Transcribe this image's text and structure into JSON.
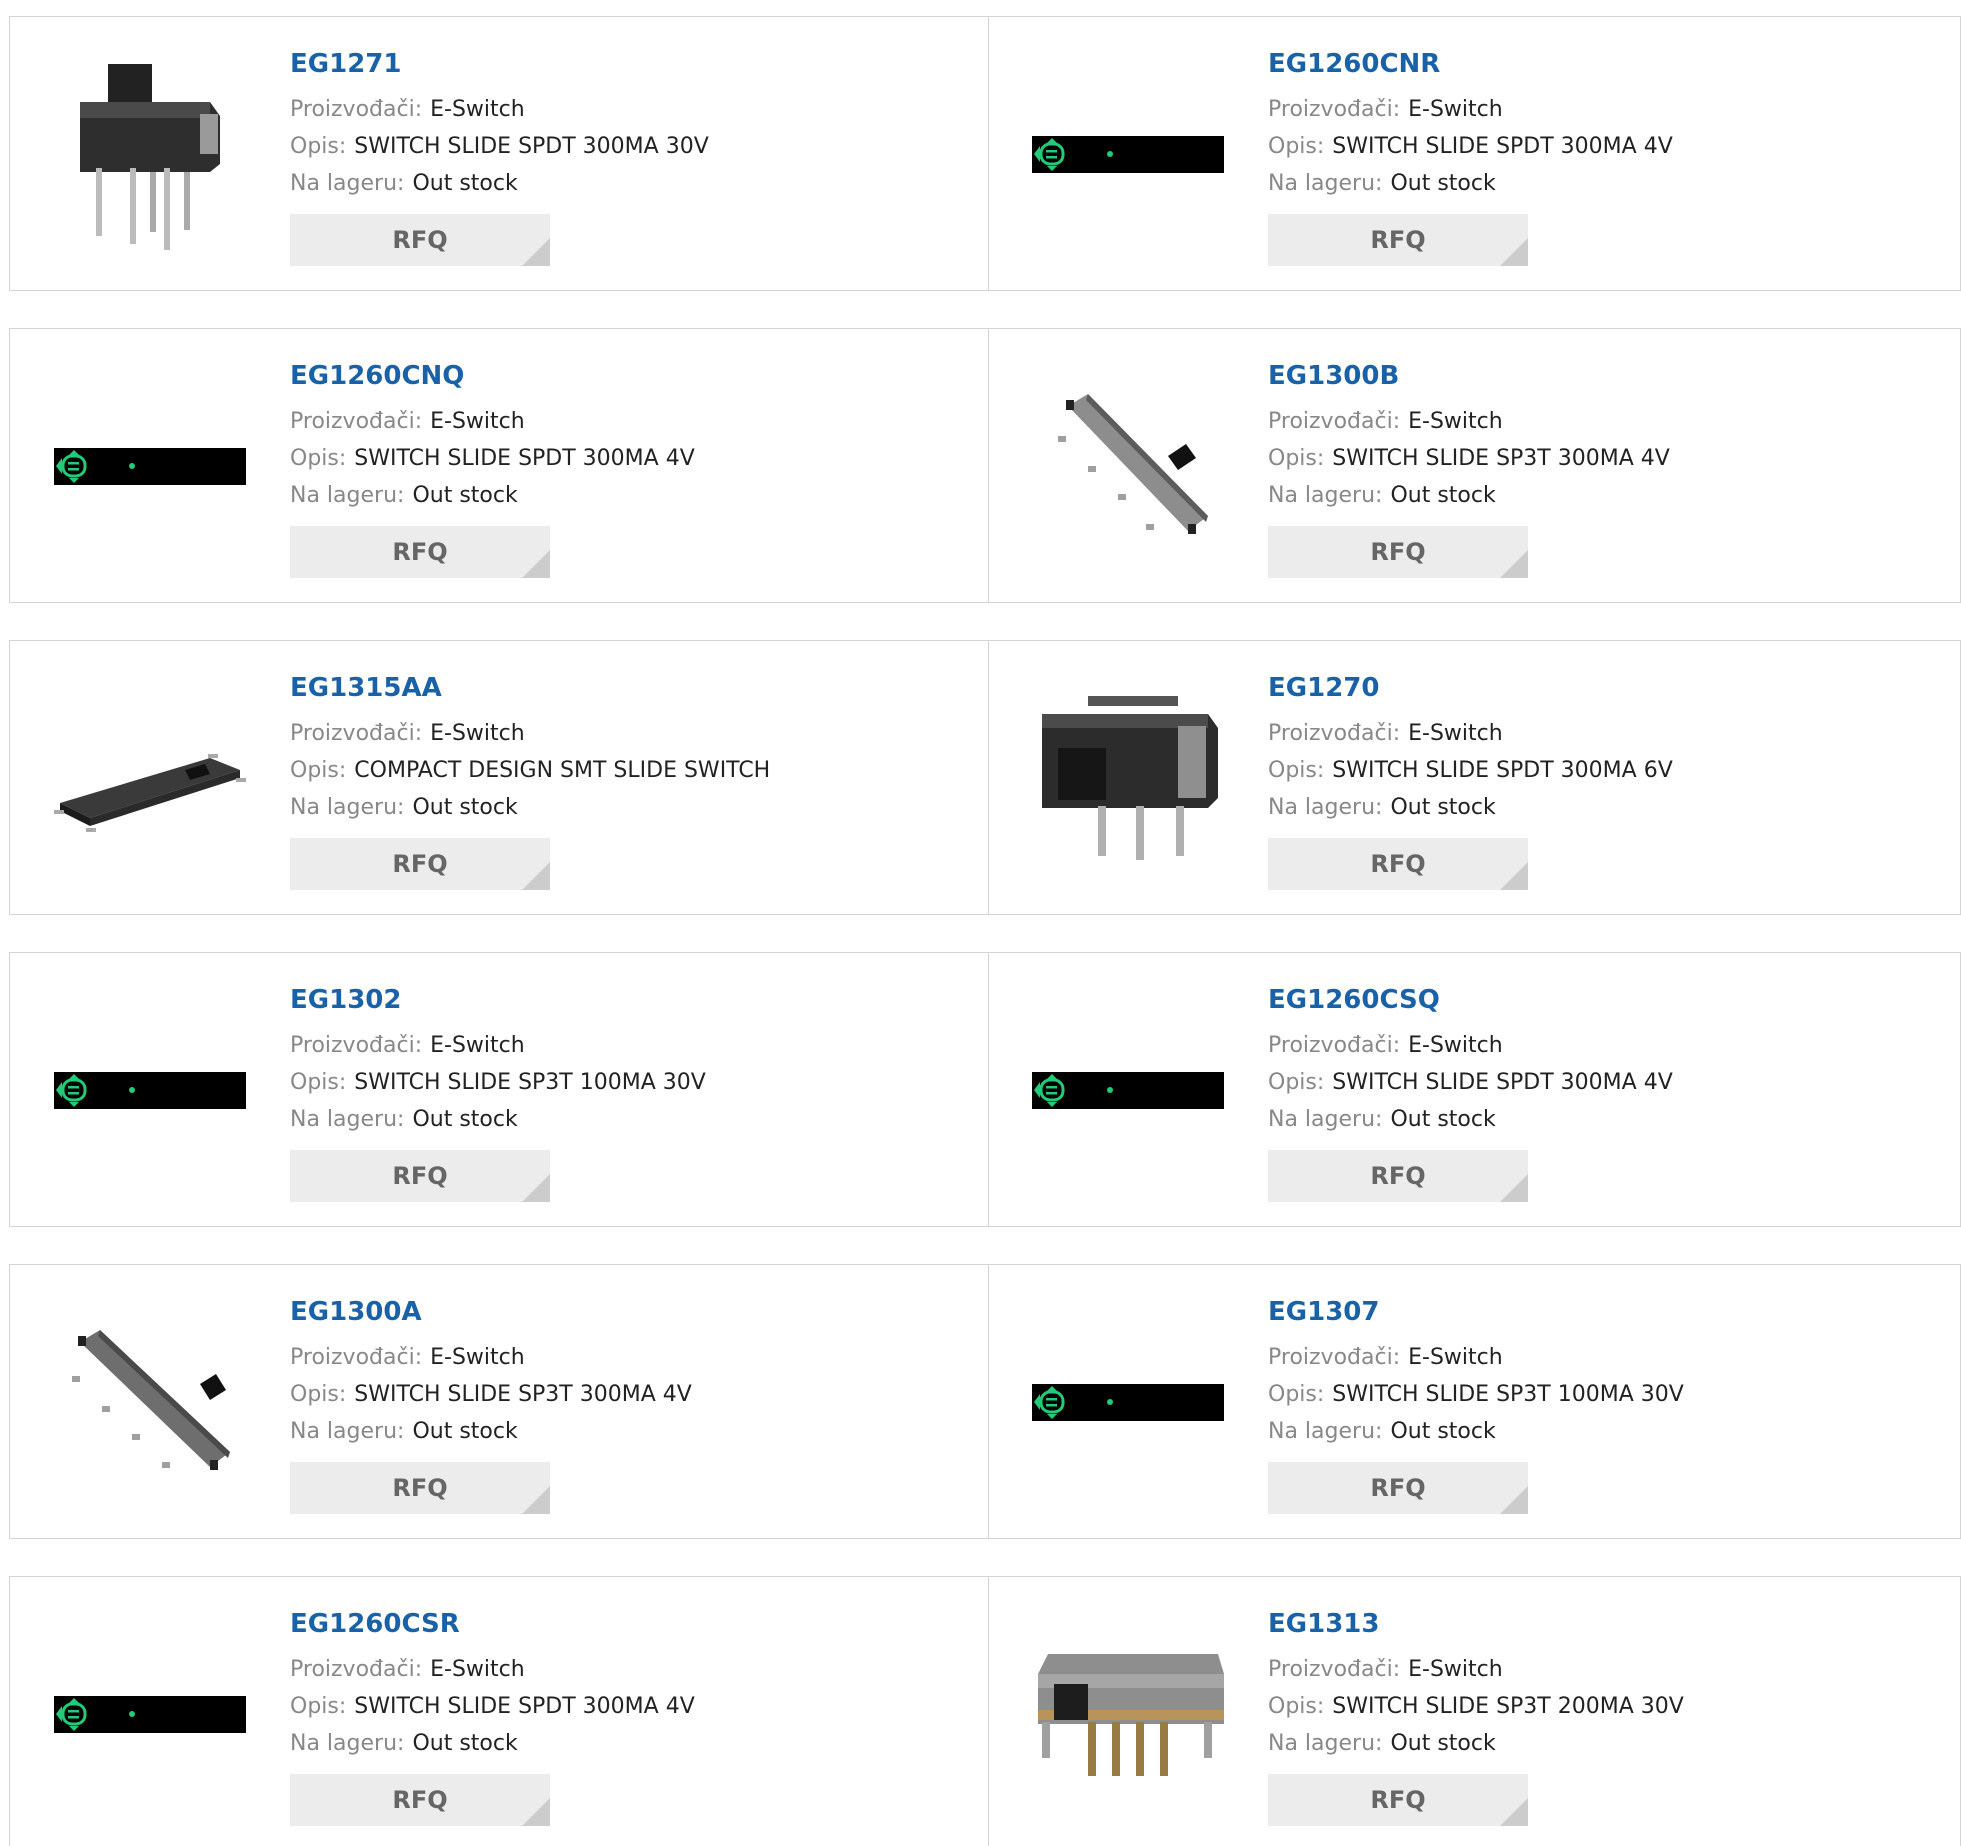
{
  "labels": {
    "manufacturer": "Proizvođači:",
    "description": "Opis:",
    "stock": "Na lageru:",
    "rfq": "RFQ"
  },
  "products": [
    {
      "name": "EG1271",
      "manufacturer": "E-Switch",
      "description": "SWITCH SLIDE SPDT 300MA 30V",
      "stock": "Out stock",
      "image": "slide-switch-through-hole"
    },
    {
      "name": "EG1260CNR",
      "manufacturer": "E-Switch",
      "description": "SWITCH SLIDE SPDT 300MA 4V",
      "stock": "Out stock",
      "image": "placeholder"
    },
    {
      "name": "EG1260CNQ",
      "manufacturer": "E-Switch",
      "description": "SWITCH SLIDE SPDT 300MA 4V",
      "stock": "Out stock",
      "image": "placeholder"
    },
    {
      "name": "EG1300B",
      "manufacturer": "E-Switch",
      "description": "SWITCH SLIDE SP3T 300MA 4V",
      "stock": "Out stock",
      "image": "slide-switch-smt-angled"
    },
    {
      "name": "EG1315AA",
      "manufacturer": "E-Switch",
      "description": "COMPACT DESIGN SMT SLIDE SWITCH",
      "stock": "Out stock",
      "image": "slide-switch-smt-flat"
    },
    {
      "name": "EG1270",
      "manufacturer": "E-Switch",
      "description": "SWITCH SLIDE SPDT 300MA 6V",
      "stock": "Out stock",
      "image": "slide-switch-through-hole-wide"
    },
    {
      "name": "EG1302",
      "manufacturer": "E-Switch",
      "description": "SWITCH SLIDE SP3T 100MA 30V",
      "stock": "Out stock",
      "image": "placeholder"
    },
    {
      "name": "EG1260CSQ",
      "manufacturer": "E-Switch",
      "description": "SWITCH SLIDE SPDT 300MA 4V",
      "stock": "Out stock",
      "image": "placeholder"
    },
    {
      "name": "EG1300A",
      "manufacturer": "E-Switch",
      "description": "SWITCH SLIDE SP3T 300MA 4V",
      "stock": "Out stock",
      "image": "slide-switch-smt-angled"
    },
    {
      "name": "EG1307",
      "manufacturer": "E-Switch",
      "description": "SWITCH SLIDE SP3T 100MA 30V",
      "stock": "Out stock",
      "image": "placeholder"
    },
    {
      "name": "EG1260CSR",
      "manufacturer": "E-Switch",
      "description": "SWITCH SLIDE SPDT 300MA 4V",
      "stock": "Out stock",
      "image": "placeholder"
    },
    {
      "name": "EG1313",
      "manufacturer": "E-Switch",
      "description": "SWITCH SLIDE SP3T 200MA 30V",
      "stock": "Out stock",
      "image": "slide-switch-metal-through-hole"
    }
  ],
  "colors": {
    "link": "#1a62a8",
    "label": "#888888",
    "value": "#222222",
    "border": "#d4d4d4",
    "button_bg": "#ececec",
    "button_text": "#666666",
    "placeholder_icon": "#22cc77"
  }
}
